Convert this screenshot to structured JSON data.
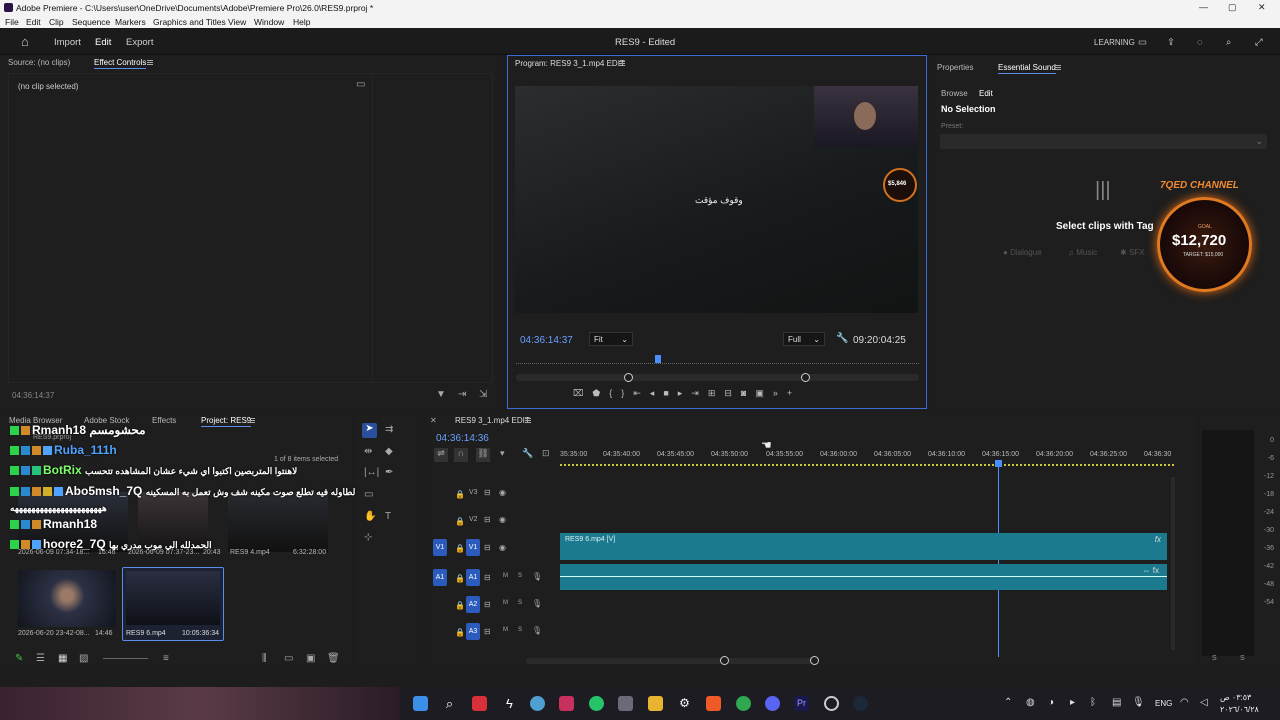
{
  "window": {
    "title": "Adobe Premiere - C:\\Users\\user\\OneDrive\\Documents\\Adobe\\Premiere Pro\\26.0\\RES9.prproj *"
  },
  "menu": [
    "File",
    "Edit",
    "Clip",
    "Sequence",
    "Markers",
    "Graphics and Titles",
    "View",
    "Window",
    "Help"
  ],
  "appbar": {
    "import": "Import",
    "edit": "Edit",
    "export": "Export",
    "doc_title": "RES9 - Edited",
    "learning": "LEARNING"
  },
  "source_panel": {
    "tab_source": "Source: (no clips)",
    "tab_effects": "Effect Controls",
    "no_clip": "(no clip selected)",
    "timecode": "04:36:14:37"
  },
  "program": {
    "tab": "Program: RES9 3_1.mp4 EDIT",
    "pause_text": "وقوف مؤقت",
    "tc_left": "04:36:14:37",
    "fit": "Fit",
    "full": "Full",
    "tc_right": "09:20:04:25"
  },
  "right_panel": {
    "tab_properties": "Properties",
    "tab_essential": "Essential Sound",
    "browse": "Browse",
    "edit": "Edit",
    "no_selection": "No Selection",
    "preset": "Preset:",
    "select_clips": "Select clips with Tag",
    "dialogue": "Dialogue",
    "music": "Music",
    "sfx": "SFX"
  },
  "overlay": {
    "channel": "7QED CHANNEL",
    "goal_label": "GOAL",
    "amount": "$12,720",
    "target": "TARGET: $15,000",
    "small_amount": "$5,846"
  },
  "project_panel": {
    "tabs": [
      "Media Browser",
      "Adobe Stock",
      "Effects",
      "Project: RES9"
    ],
    "project_file": "RES9.prproj",
    "items_selected": "1 of 8 items selected",
    "clips": [
      {
        "date": "2026-06-09 07:34-18...",
        "dur": "16:46"
      },
      {
        "date": "2026-06-09 07:37-23...",
        "dur": "20:43"
      },
      {
        "name": "RES9 4.mp4",
        "dur": "6:32:28:00"
      },
      {
        "date": "2026-06-20 23-42-08...",
        "dur": "14:46"
      },
      {
        "name": "RES9 6.mp4",
        "dur": "10:05:36:34"
      }
    ]
  },
  "chat": [
    {
      "user": "Rmanh18",
      "msg": "محشومسم",
      "color": "#ffffff"
    },
    {
      "user": "Ruba_111h",
      "msg": "",
      "color": "#4fa3ff"
    },
    {
      "user": "BotRix",
      "msg": "لاهنتوا المتربصين اكتبوا اي شيء عشان المشاهده تتحسب",
      "color": "#7dff6a"
    },
    {
      "user": "Abo5msh_7Q",
      "msg": "رل الطاوله فيه تطلع صوت مكينه شف وش تعمل به المسكينه",
      "color": "#ffffff"
    },
    {
      "user": "Rmanh18",
      "msg": "ههههههههههههههههههههههه",
      "color": "#ffffff"
    },
    {
      "user": "hoore2_7Q",
      "msg": "الحمدلله الي موب مدري بها",
      "color": "#ffffff"
    }
  ],
  "timeline": {
    "tab": "RES9 3_1.mp4 EDIT",
    "timecode": "04:36:14:36",
    "ruler": [
      "35:35:00",
      "04:35:40:00",
      "04:35:45:00",
      "04:35:50:00",
      "04:35:55:00",
      "04:36:00:00",
      "04:36:05:00",
      "04:36:10:00",
      "04:36:15:00",
      "04:36:20:00",
      "04:36:25:00",
      "04:36:30"
    ],
    "tracks": [
      {
        "id": "V3"
      },
      {
        "id": "V2"
      },
      {
        "id": "V1",
        "src": "V1"
      },
      {
        "id": "A1",
        "src": "A1"
      },
      {
        "id": "A2"
      },
      {
        "id": "A3"
      }
    ],
    "clip_label": "RES9 6.mp4 [V]"
  },
  "meter": {
    "labels": [
      "0",
      "-6",
      "-12",
      "-18",
      "-24",
      "-30",
      "-36",
      "-42",
      "-48",
      "-54"
    ],
    "s_left": "S",
    "s_right": "S"
  },
  "tray": {
    "lang": "ENG",
    "time": "٠٣:٥٣ ص",
    "date": "٢٠٢٦/٠٦/٢٨"
  }
}
